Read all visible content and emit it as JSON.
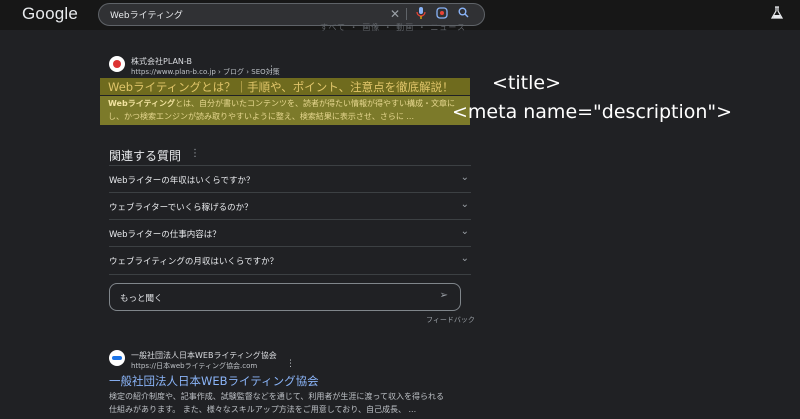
{
  "header": {
    "logo": "Google",
    "query": "Webライティング",
    "clear_icon": "close-icon",
    "mic_icon": "mic-icon",
    "lens_icon": "lens-icon",
    "search_icon": "search-icon",
    "labs_icon": "flask-icon",
    "faded_nav": "すべて ・ 画像 ・ 動画 ・ ニュース"
  },
  "result1": {
    "site_name": "株式会社PLAN-B",
    "url": "https://www.plan-b.co.jp › ブログ › SEO対策",
    "title": "Webライティングとは？｜手順や、ポイント、注意点を徹底解説！",
    "desc_bold": "Webライティング",
    "desc_line1_rest": "とは、自分が書いたコンテンツを、読者が得たい情報が得やすい構成・文章に",
    "desc_line2": "し、かつ検索エンジンが読み取りやすいように整え、検索結果に表示させ、さらに ...",
    "highlight_color": "#7c7a2a"
  },
  "annotations": {
    "title_tag": "<title>",
    "meta_tag": "<meta name=\"description\">"
  },
  "related_questions": {
    "heading": "関連する質問",
    "items": [
      "Webライターの年収はいくらですか？",
      "ウェブライターでいくら稼げるのか？",
      "Webライターの仕事内容は？",
      "ウェブライティングの月収はいくらですか？"
    ]
  },
  "ask": {
    "placeholder": "もっと聞く",
    "feedback": "フィードバック"
  },
  "result2": {
    "site_name": "一般社団法人日本WEBライティング協会",
    "url": "https://日本webライティング協会.com",
    "title": "一般社団法人日本WEBライティング協会",
    "desc_line1": "検定の紹介制度や、記事作成、試験監督などを通じて、利用者が生涯に渡って収入を得られる",
    "desc_line2": "仕組みがあります。 また、様々なスキルアップ方法をご用意しており、自己成長、 ..."
  },
  "colors": {
    "background": "#202124",
    "link_blue": "#8ab4f8",
    "highlight_text": "#e0c56a"
  }
}
